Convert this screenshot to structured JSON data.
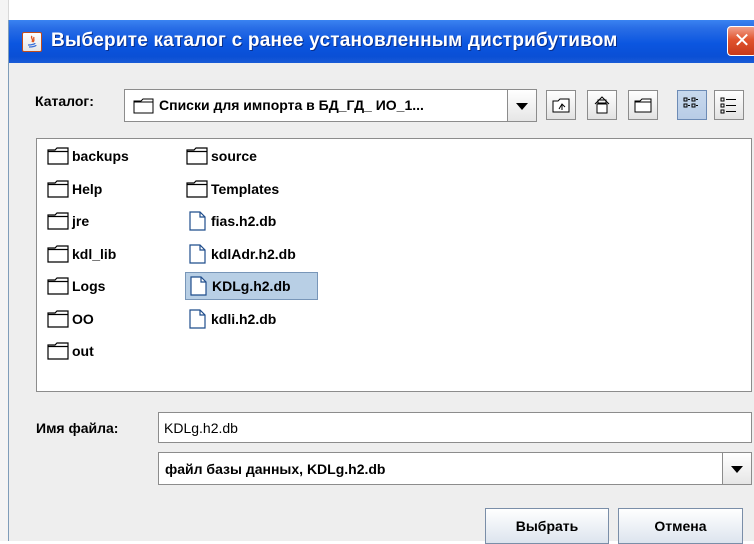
{
  "dialog": {
    "title": "Выберите каталог с ранее установленным дистрибутивом",
    "close_glyph": "✕"
  },
  "toolbar": {
    "look_in_label": "Каталог:",
    "look_in_value": "Списки для импорта в БД_ГД_ ИО_1...",
    "buttons": [
      {
        "name": "up-one-level-icon"
      },
      {
        "name": "home-icon"
      },
      {
        "name": "new-folder-icon"
      },
      {
        "name": "list-view-icon",
        "selected": true
      },
      {
        "name": "details-view-icon"
      }
    ]
  },
  "files": [
    {
      "name": "backups",
      "type": "folder"
    },
    {
      "name": "Help",
      "type": "folder"
    },
    {
      "name": "jre",
      "type": "folder"
    },
    {
      "name": "kdl_lib",
      "type": "folder"
    },
    {
      "name": "Logs",
      "type": "folder"
    },
    {
      "name": "OO",
      "type": "folder"
    },
    {
      "name": "out",
      "type": "folder"
    },
    {
      "name": "source",
      "type": "folder"
    },
    {
      "name": "Templates",
      "type": "folder"
    },
    {
      "name": "fias.h2.db",
      "type": "file"
    },
    {
      "name": "kdlAdr.h2.db",
      "type": "file"
    },
    {
      "name": "KDLg.h2.db",
      "type": "file",
      "selected": true
    },
    {
      "name": "kdli.h2.db",
      "type": "file"
    }
  ],
  "filename": {
    "label": "Имя файла:",
    "value": "KDLg.h2.db"
  },
  "filetype": {
    "value": "файл базы данных, KDLg.h2.db"
  },
  "buttons": {
    "approve": "Выбрать",
    "cancel": "Отмена"
  },
  "colors": {
    "titlebar": "#0b56e0",
    "selection": "#b8cfe5",
    "window_bg": "#eeeeee"
  }
}
